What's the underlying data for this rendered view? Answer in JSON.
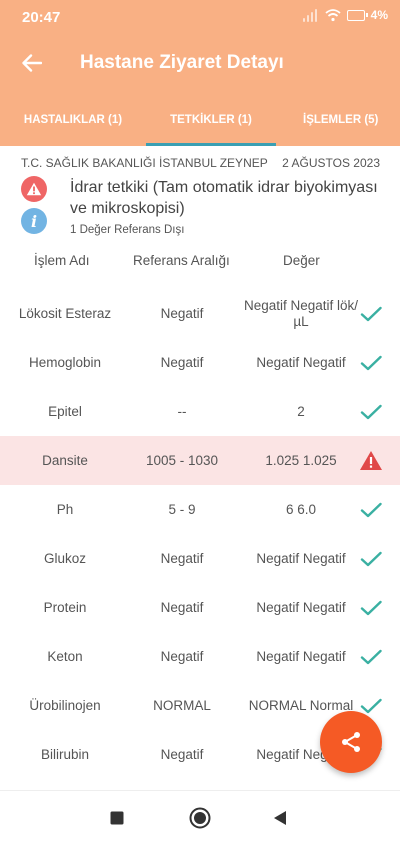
{
  "status_bar": {
    "time": "20:47",
    "battery": "4"
  },
  "app_bar": {
    "title": "Hastane Ziyaret Detayı",
    "back_icon": "arrow-left-icon"
  },
  "tabs": [
    {
      "label": "HASTALIKLAR (1)"
    },
    {
      "label": "TETKİKLER (1)",
      "selected": true
    },
    {
      "label": "İŞLEMLER (5)"
    }
  ],
  "visit": {
    "institution": "T.C. SAĞLIK BAKANLIĞI İSTANBUL ZEYNEP",
    "date": "2 AĞUSTOS 2023",
    "test_name": "İdrar tetkiki (Tam otomatik idrar biyokimyası ve mikroskopisi)",
    "out_of_range": "1 Değer Referans Dışı"
  },
  "columns": {
    "name": "İşlem Adı",
    "range": "Referans Aralığı",
    "value": "Değer"
  },
  "results": [
    {
      "name": "Lökosit Esteraz",
      "range": "Negatif",
      "value": "Negatif Negatif lök/µL",
      "status": "ok"
    },
    {
      "name": "Hemoglobin",
      "range": "Negatif",
      "value": "Negatif Negatif",
      "status": "ok"
    },
    {
      "name": "Epitel",
      "range": "--",
      "value": "2",
      "status": "ok"
    },
    {
      "name": "Dansite",
      "range": "1005 - 1030",
      "value": "1.025 1.025",
      "status": "alert"
    },
    {
      "name": "Ph",
      "range": "5 - 9",
      "value": "6 6.0",
      "status": "ok"
    },
    {
      "name": "Glukoz",
      "range": "Negatif",
      "value": "Negatif Negatif",
      "status": "ok"
    },
    {
      "name": "Protein",
      "range": "Negatif",
      "value": "Negatif Negatif",
      "status": "ok"
    },
    {
      "name": "Keton",
      "range": "Negatif",
      "value": "Negatif Negatif",
      "status": "ok"
    },
    {
      "name": "Ürobilinojen",
      "range": "NORMAL",
      "value": "NORMAL Normal",
      "status": "ok"
    },
    {
      "name": "Bilirubin",
      "range": "Negatif",
      "value": "Negatif Negatif",
      "status": "ok"
    }
  ],
  "colors": {
    "header": "#f9b084",
    "accent": "#3a9fb3",
    "check": "#3ab0a2",
    "alert": "#e04848",
    "alert_row": "#fbe4e4",
    "fab": "#f55a25"
  },
  "fab": {
    "icon": "share-icon"
  },
  "nav": {
    "icons": [
      "recents-square-icon",
      "home-circle-icon",
      "back-triangle-icon"
    ]
  }
}
